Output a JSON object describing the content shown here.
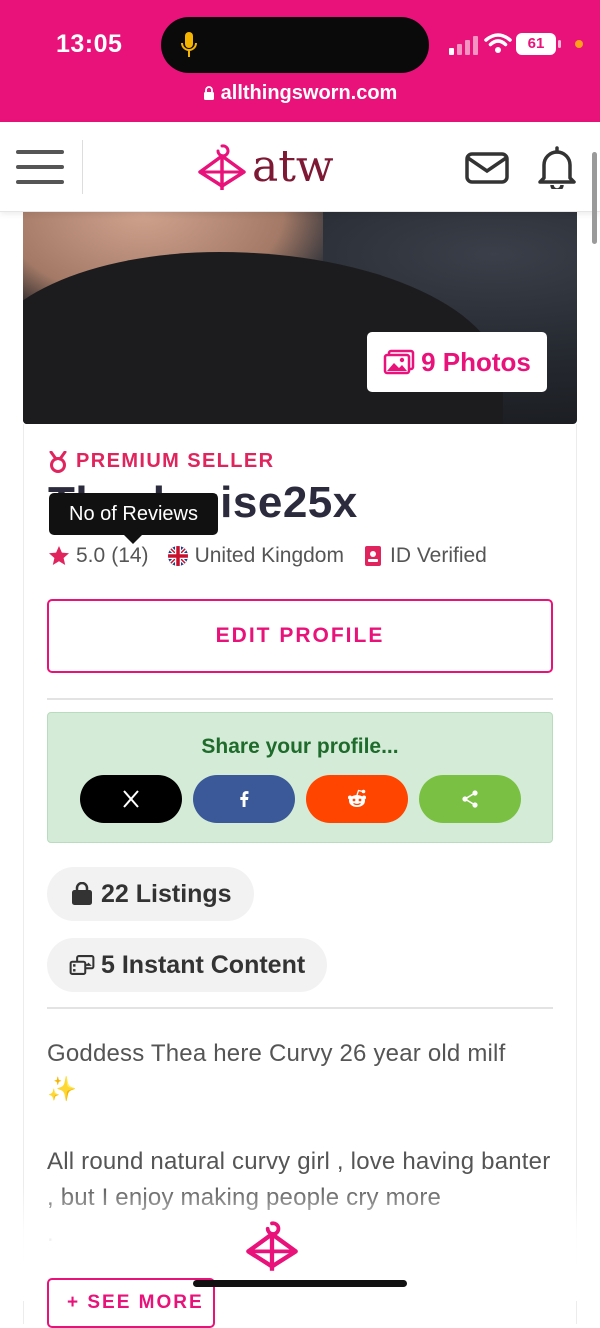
{
  "status_bar": {
    "time": "13:05",
    "battery": "61",
    "url": "allthingsworn.com"
  },
  "navbar": {
    "logo_text": "atw",
    "icons": [
      "menu-icon",
      "hanger-logo-icon",
      "mail-icon",
      "bell-icon"
    ]
  },
  "hero": {
    "photos_label": "9 Photos"
  },
  "profile": {
    "badge": "PREMIUM SELLER",
    "username": "Thealouise25x",
    "tooltip": "No of Reviews",
    "rating": "5.0",
    "reviews": "(14)",
    "country": "United Kingdom",
    "verified": "ID Verified",
    "edit_label": "EDIT PROFILE"
  },
  "share": {
    "title": "Share your profile...",
    "buttons": [
      {
        "name": "x",
        "icon": "x-icon",
        "color": "#000000"
      },
      {
        "name": "facebook",
        "icon": "facebook-icon",
        "color": "#3b5998"
      },
      {
        "name": "reddit",
        "icon": "reddit-icon",
        "color": "#ff4500"
      },
      {
        "name": "share",
        "icon": "share-icon",
        "color": "#7ac143"
      }
    ]
  },
  "stats": {
    "listings": "22 Listings",
    "instant": "5 Instant Content"
  },
  "bio": {
    "line1": "Goddess Thea here Curvy 26 year old milf",
    "sparkle": "✨",
    "line2": "All round natural curvy girl , love having banter , but I enjoy making people cry more",
    "line3": "."
  },
  "see_more": "+ SEE MORE",
  "colors": {
    "brand_pink": "#e9127a",
    "logo_maroon": "#7d1934",
    "share_bg": "#d4ecd7"
  }
}
